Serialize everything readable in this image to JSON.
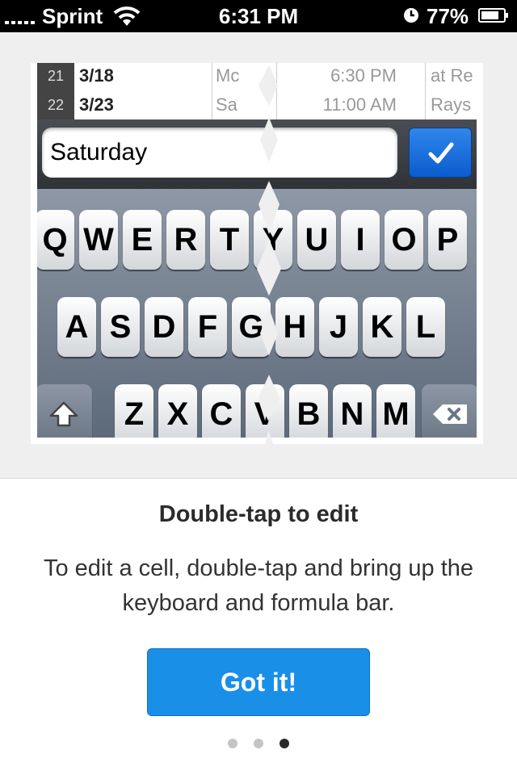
{
  "status_bar": {
    "carrier": "Sprint",
    "time": "6:31 PM",
    "battery": "77%"
  },
  "illustration": {
    "rows": [
      {
        "num": "21",
        "date": "3/18",
        "day": "Mc",
        "time": "6:30 PM",
        "loc": "at Re"
      },
      {
        "num": "22",
        "date": "3/23",
        "day": "Sa",
        "time": "11:00 AM",
        "loc": "Rays"
      }
    ],
    "formula_value": "Saturday",
    "keys_row1": [
      "Q",
      "W",
      "E",
      "R",
      "T",
      "Y",
      "U",
      "I",
      "O",
      "P"
    ],
    "keys_row2": [
      "A",
      "S",
      "D",
      "F",
      "G",
      "H",
      "J",
      "K",
      "L"
    ],
    "keys_row3": [
      "Z",
      "X",
      "C",
      "V",
      "B",
      "N",
      "M"
    ]
  },
  "onboarding": {
    "title": "Double-tap to edit",
    "description": "To edit a cell, double-tap and bring up the keyboard and formula bar.",
    "button_label": "Got it!",
    "page_count": 3,
    "active_page": 3
  }
}
